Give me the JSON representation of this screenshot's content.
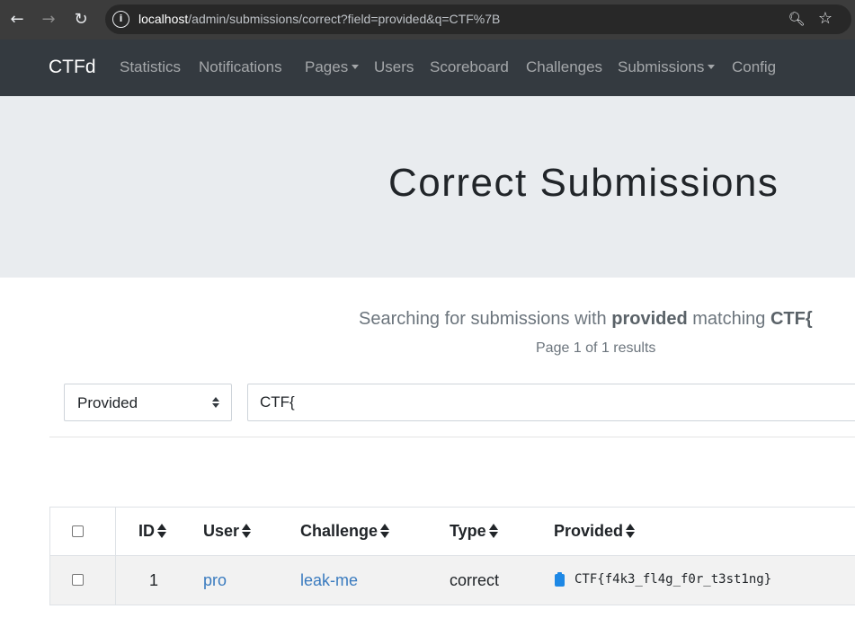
{
  "browser": {
    "url_host": "localhost",
    "url_path": "/admin/submissions/correct?field=provided&q=CTF%7B",
    "back_icon": "arrow-left-icon",
    "forward_icon": "arrow-right-icon",
    "reload_icon": "reload-icon",
    "info_icon": "info-icon",
    "zoom_icon": "zoom-icon",
    "star_icon": "star-icon"
  },
  "navbar": {
    "brand": "CTFd",
    "items": [
      {
        "label": "Statistics"
      },
      {
        "label": "Notifications"
      },
      {
        "label": "Pages",
        "dropdown": true
      },
      {
        "label": "Users"
      },
      {
        "label": "Scoreboard"
      },
      {
        "label": "Challenges"
      },
      {
        "label": "Submissions",
        "dropdown": true
      },
      {
        "label": "Config"
      }
    ]
  },
  "header": {
    "title": "Correct Submissions"
  },
  "search": {
    "prefix": "Searching for submissions with",
    "field": "provided",
    "middle": "matching",
    "query": "CTF{",
    "page_info": "Page 1 of 1 results",
    "field_select_value": "Provided",
    "query_input_value": "CTF{"
  },
  "table": {
    "columns": [
      "ID",
      "User",
      "Challenge",
      "Type",
      "Provided"
    ],
    "rows": [
      {
        "id": "1",
        "user": "pro",
        "challenge": "leak-me",
        "type": "correct",
        "provided": "CTF{f4k3_fl4g_f0r_t3st1ng}"
      }
    ]
  },
  "colors": {
    "navbar_bg": "#343a40",
    "jumbotron_bg": "#e9ecef",
    "link": "#3a7bbf",
    "row_bg": "#f2f2f2"
  }
}
